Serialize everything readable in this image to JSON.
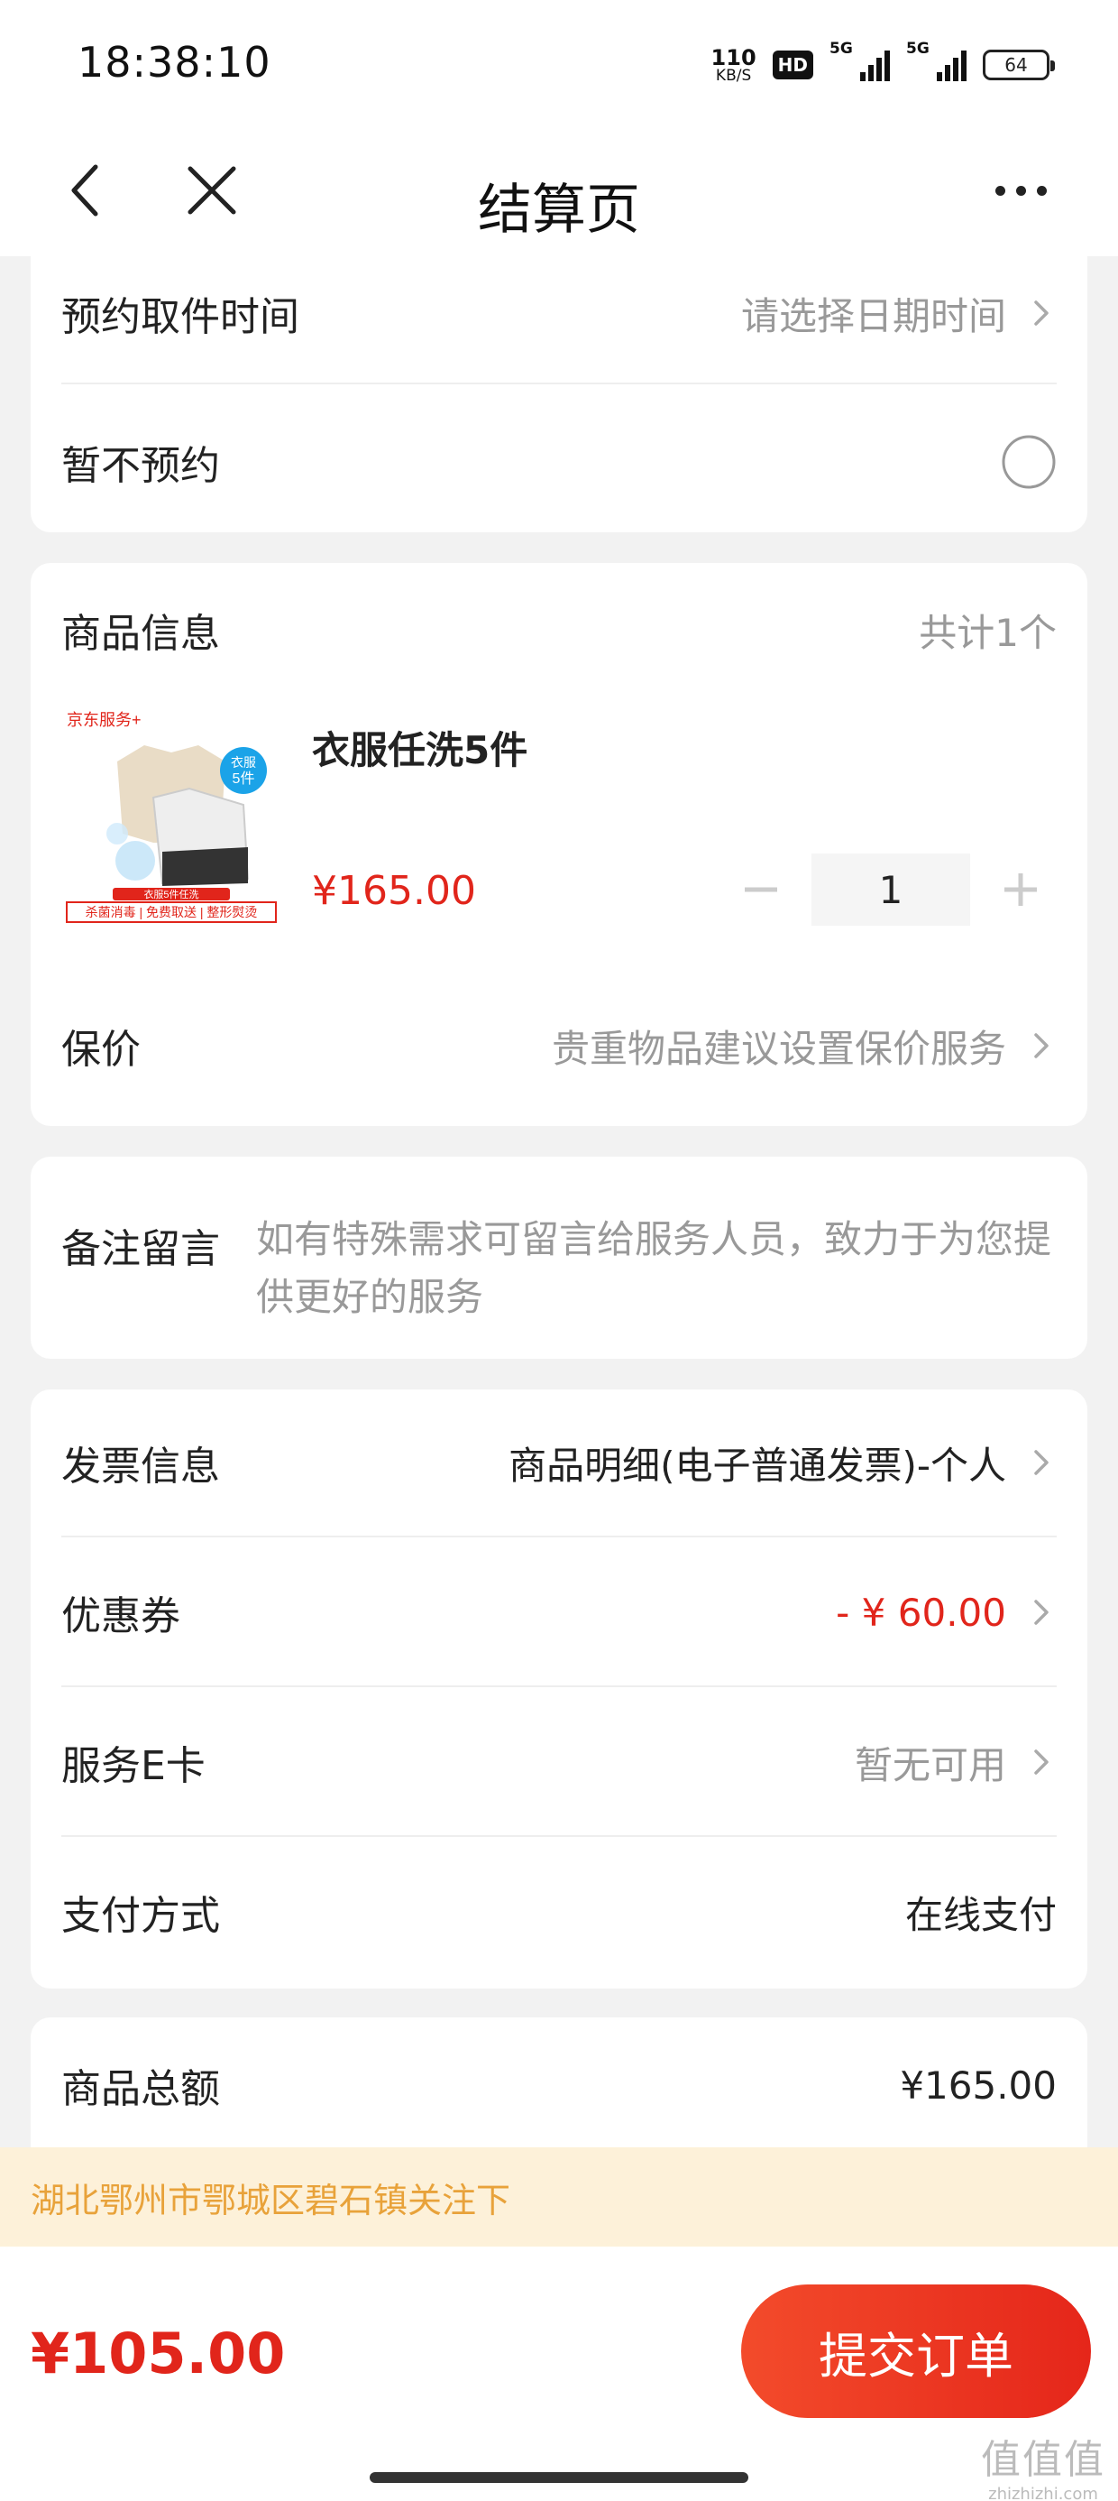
{
  "status_bar": {
    "time": "18:38:10",
    "net_speed": "110",
    "net_unit": "KB/S",
    "hd": "HD",
    "sig1": "5G",
    "sig2": "5G",
    "battery": "64"
  },
  "nav": {
    "title": "结算页"
  },
  "pickup": {
    "time_label": "预约取件时间",
    "time_value": "请选择日期时间",
    "no_reserve_label": "暂不预约"
  },
  "product_section": {
    "title": "商品信息",
    "count": "共计1个",
    "item": {
      "name": "衣服任洗5件",
      "price": "¥165.00",
      "quantity": "1",
      "image": {
        "brand": "京东服务+",
        "tag_line1": "衣服",
        "tag_line2": "5件",
        "banner": "衣服5件任洗",
        "features": "杀菌消毒 | 免费取送 | 整形熨烫"
      }
    },
    "insured_label": "保价",
    "insured_value": "贵重物品建议设置保价服务"
  },
  "remark": {
    "label": "备注留言",
    "placeholder": "如有特殊需求可留言给服务人员，致力于为您提供更好的服务"
  },
  "order_options": {
    "invoice_label": "发票信息",
    "invoice_value": "商品明细(电子普通发票)-个人",
    "coupon_label": "优惠券",
    "coupon_value": "- ¥ 60.00",
    "ecard_label": "服务E卡",
    "ecard_value": "暂无可用",
    "payment_label": "支付方式",
    "payment_value": "在线支付"
  },
  "summary": {
    "total_label": "商品总额",
    "total_value": "¥165.00"
  },
  "address_notice": "湖北鄂州市鄂城区碧石镇关注下",
  "footer": {
    "total": "¥105.00",
    "submit_label": "提交订单"
  },
  "watermark": {
    "logo": "值值值",
    "url": "zhizhizhi.com"
  },
  "colors": {
    "accent": "#e1251b",
    "notice_bg": "#fdf1d9",
    "notice_text": "#e8a23a"
  }
}
